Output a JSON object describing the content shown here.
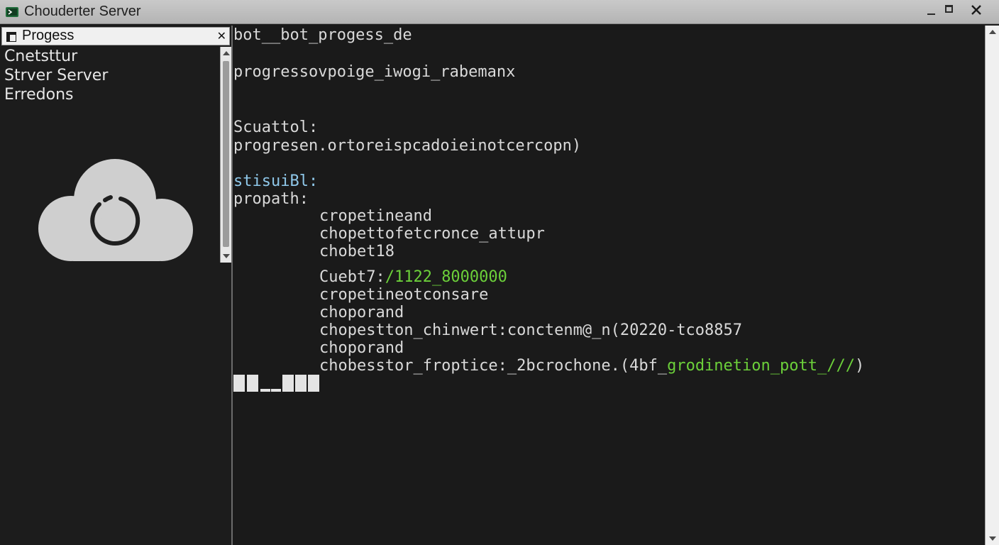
{
  "window": {
    "title": "Chouderter Server",
    "icon": "terminal-app-icon",
    "controls": [
      "minimize-icon",
      "maximize-icon",
      "close-icon"
    ]
  },
  "left_panel": {
    "tab_label": "Progess",
    "tab_icon": "window-icon",
    "close_glyph": "✕",
    "items": [
      {
        "label": "Cnetsttur"
      },
      {
        "label": "Strver Server"
      },
      {
        "label": "Erredons"
      }
    ],
    "illustration_icon": "cloud-loading-icon"
  },
  "console": {
    "lines": {
      "l1": "bot__bot_progess_de",
      "l2": "progressovpoige_iwogi_rabemanx",
      "l3": "Scuattol:",
      "l4": "progresen.ortoreispcadoieinotcercopn)",
      "l5": "stisuiBl:",
      "l6": "propath:",
      "l7": "cropetineand",
      "l8": "chopettofetcronce_attupr",
      "l9": "chobet18",
      "l10_prefix": "Cuebt7:",
      "l10_value": "/1122_8000000",
      "l11": "cropetineotconsare",
      "l12": "choporand",
      "l13": "chopestton_chinwert:conctenm@_n(20220-tco8857",
      "l14": "choporand",
      "l15_prefix": "chobesstor_froptice:_2bcrochone.(4bf_",
      "l15_highlight": "grodinetion_pott_///",
      "l15_suffix": ")"
    },
    "colors": {
      "text": "#d9d9d9",
      "label_blue": "#8fc8ea",
      "value_green": "#6cd03a",
      "background": "#1a1a1a"
    }
  }
}
